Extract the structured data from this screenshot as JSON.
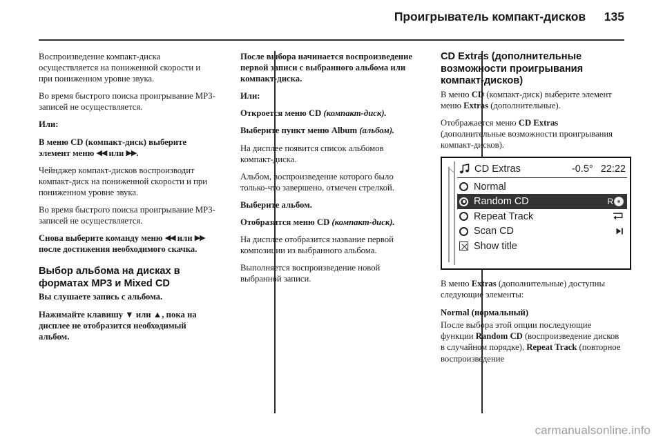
{
  "header": {
    "title": "Проигрыватель компакт-дисков",
    "page_number": "135"
  },
  "column1": {
    "p1": "Воспроизведение компакт-диска осуществляется на пониженной скорости и при пониженном уровне звука.",
    "p2": "Во время быстрого поиска проигрывание MP3-записей не осуществляется.",
    "p3_label": "Или:",
    "p4_a": "В меню CD (компакт-диск) выберите элемент меню ",
    "p4_icon1": "◀◀",
    "p4_mid": " или ",
    "p4_icon2": "▶▶",
    "p4_end": ".",
    "p5": "Чейнджер компакт-дисков воспроизводит компакт-диск на пониженной скорости и при пониженном уровне звука.",
    "p6": "Во время быстрого поиска проигрывание MP3-записей не осуществляется.",
    "p7_a": "Снова выберите команду меню ",
    "p7_icon1": "◀◀",
    "p7_mid": " или ",
    "p7_icon2": "▶▶",
    "p7_end": " после достижения необходимого скачка.",
    "heading": "Выбор альбома на дисках в форматах MP3 и Mixed CD",
    "lead": "Вы слушаете запись с альбома.",
    "p8": "Нажимайте клавишу ▼ или ▲, пока на дисплее не отобразится необходимый альбом."
  },
  "column2": {
    "p1": "После выбора начинается воспроизведение первой записи с выбранного альбома или компакт-диска.",
    "p2_label": "Или:",
    "p3_a": "Откроется меню ",
    "p3_b": "CD",
    "p3_c": " (компакт-диск).",
    "p4_a": "Выберите пункт меню ",
    "p4_b": "Album",
    "p4_c": " (альбом).",
    "p5": "На дисплее появится список альбомов компакт-диска.",
    "p6": "Альбом, воспроизведение которого было только-что завершено, отмечен стрелкой.",
    "p7": "Выберите альбом.",
    "p8_a": "Отобразится меню ",
    "p8_b": "CD",
    "p8_c": " (компакт-диск).",
    "p9": "На дисплее отобразится название первой композиции из выбранного альбома.",
    "p10": "Выполняется воспроизведение новой выбранной записи."
  },
  "column3": {
    "heading": "CD Extras (дополнительные возможности проигрывания компакт-дисков)",
    "p1_a": "В меню ",
    "p1_b": "CD",
    "p1_c": " (компакт-диск) выберите элемент меню ",
    "p1_d": "Extras",
    "p1_e": " (дополнительные).",
    "p2_a": "Отображается меню ",
    "p2_b": "CD Extras",
    "p2_c": " (дополнительные возможности проигрывания компакт-дисков).",
    "p3_a": "В меню ",
    "p3_b": "Extras",
    "p3_c": " (дополнительные) доступны следующие элементы:",
    "sub1_a": "Normal",
    "sub1_b": " (нормальный)",
    "p4_a": "После выбора этой опции последующие функции ",
    "p4_b": "Random CD",
    "p4_c": " (воспроизведение дисков в случайном порядке), ",
    "p4_d": "Repeat Track",
    "p4_e": " (повторное воспроизведение"
  },
  "display": {
    "title": "CD Extras",
    "note_icon": "music-note-icon",
    "temperature": "-0.5°",
    "time": "22:22",
    "items": [
      {
        "label": "Normal",
        "control": "radio",
        "selected": false,
        "checked": false,
        "right_icon": "none"
      },
      {
        "label": "Random CD",
        "control": "radio",
        "selected": true,
        "checked": true,
        "right_icon": "random-disc-icon",
        "right_text": "R"
      },
      {
        "label": "Repeat Track",
        "control": "radio",
        "selected": false,
        "checked": false,
        "right_icon": "repeat-icon"
      },
      {
        "label": "Scan CD",
        "control": "radio",
        "selected": false,
        "checked": false,
        "right_icon": "scan-next-icon"
      },
      {
        "label": "Show title",
        "control": "checkbox",
        "selected": false,
        "checked": true,
        "right_icon": "none"
      }
    ],
    "colors": {
      "selected_row_bg": "#333333",
      "selected_row_fg": "#ffffff",
      "screen_bg": "#ffffff",
      "frame": "#111111"
    }
  },
  "watermark": {
    "text": "carmanualsonline.info"
  }
}
